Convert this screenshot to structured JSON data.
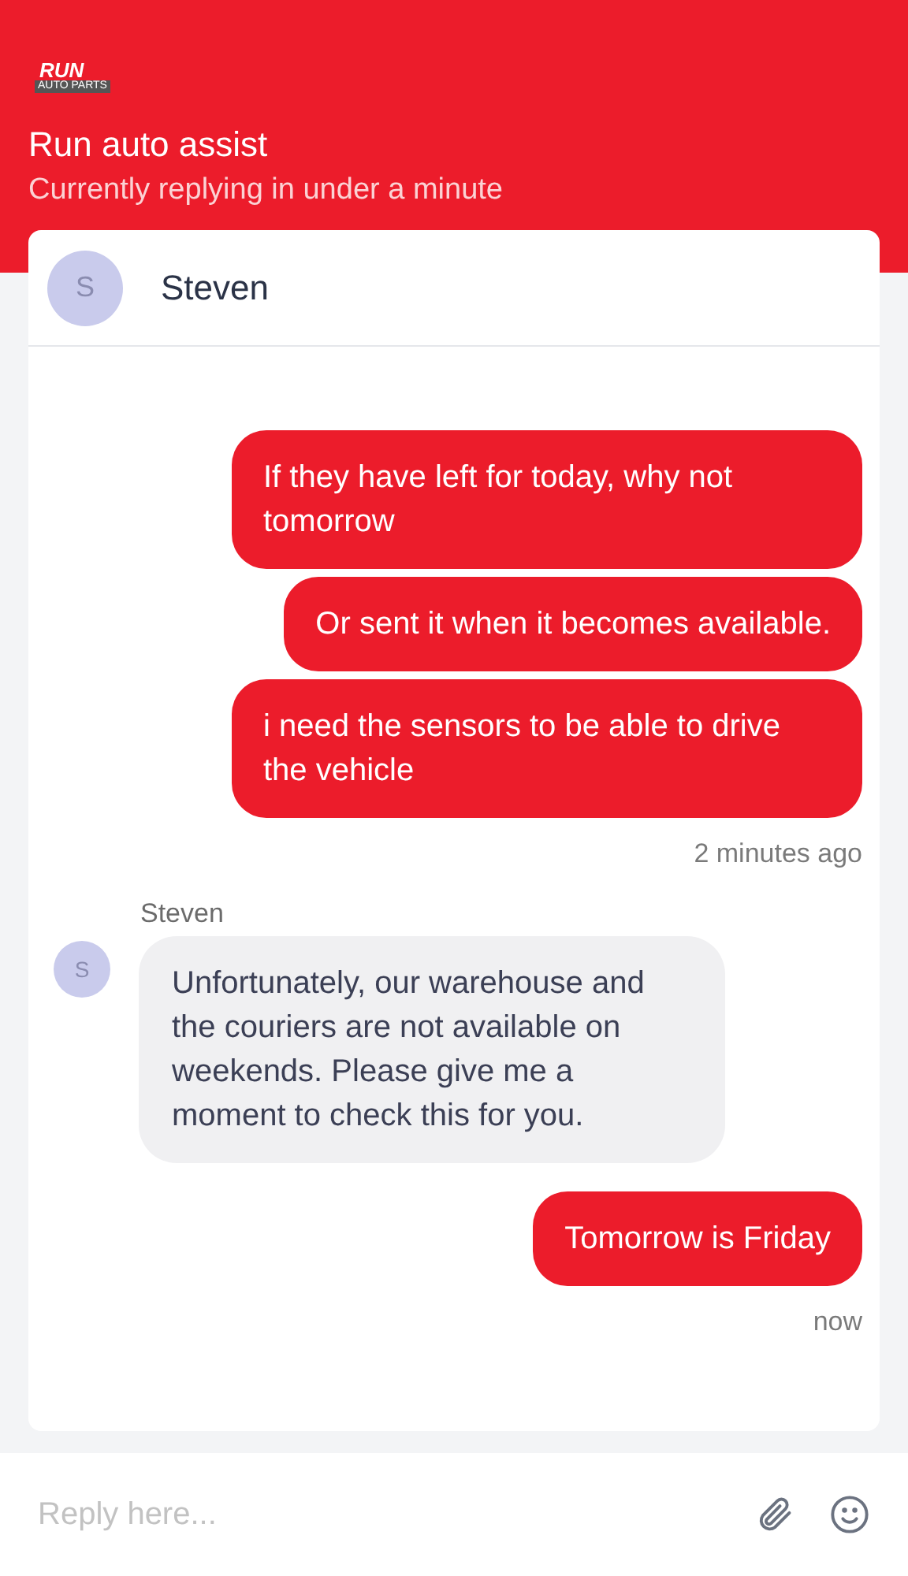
{
  "header": {
    "logo": {
      "name": "RUN",
      "tagline": "AUTO PARTS"
    },
    "title": "Run auto assist",
    "subtitle": "Currently replying in under a minute"
  },
  "agent": {
    "initial": "S",
    "name": "Steven"
  },
  "messages": [
    {
      "kind": "outgoing",
      "bubbles": [
        "If they have left for today, why not tomorrow",
        "Or sent it when it becomes available.",
        "i need the sensors to be able to drive the vehicle"
      ],
      "time": "2 minutes ago"
    },
    {
      "kind": "incoming",
      "sender": "Steven",
      "initial": "S",
      "bubbles": [
        "Unfortunately, our warehouse and the couriers are not available on weekends. Please give me a moment to check this for you."
      ]
    },
    {
      "kind": "outgoing",
      "bubbles": [
        "Tomorrow is Friday"
      ],
      "time": "now"
    }
  ],
  "composer": {
    "placeholder": "Reply here..."
  }
}
